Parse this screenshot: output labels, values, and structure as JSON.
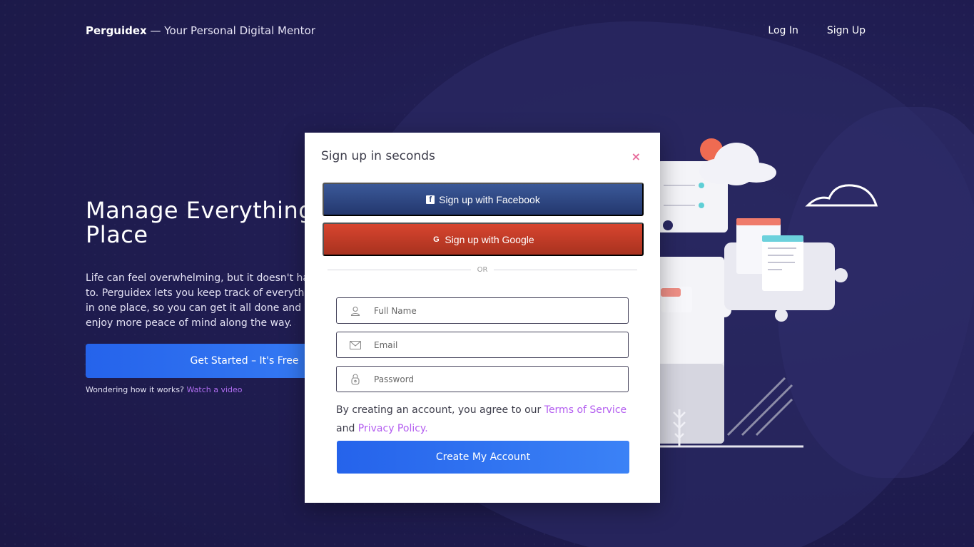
{
  "header": {
    "brand_name": "Perguidex",
    "brand_tagline": "— Your Personal Digital Mentor",
    "nav": {
      "login": "Log In",
      "signup": "Sign Up"
    }
  },
  "hero": {
    "title": "Manage Everything in One Place",
    "description": "Life can feel overwhelming, but it doesn't have to. Perguidex lets you keep track of everything in one place, so you can get it all done and enjoy more peace of mind along the way.",
    "cta_label": "Get Started – It's Free",
    "hint_text": "Wondering how it works?",
    "hint_link": "Watch a video"
  },
  "modal": {
    "title": "Sign up in seconds",
    "close_symbol": "×",
    "facebook_label": "Sign up with Facebook",
    "google_label": "Sign up with Google",
    "facebook_glyph": "f",
    "google_glyph": "G",
    "divider_text": "OR",
    "fields": {
      "full_name_placeholder": "Full Name",
      "email_placeholder": "Email",
      "password_placeholder": "Password"
    },
    "terms_prefix": "By creating an account, you agree to our",
    "terms_link": "Terms of Service",
    "terms_and": "and",
    "privacy_link": "Privacy Policy.",
    "submit_label": "Create My Account"
  },
  "icons": {
    "facebook": "facebook-icon",
    "google": "google-icon",
    "user": "user-icon",
    "email": "envelope-icon",
    "password": "lock-icon",
    "close": "close-icon"
  },
  "colors": {
    "background": "#201d52",
    "primary": "#2563eb",
    "facebook": "#3b5998",
    "google": "#d8452f",
    "link": "#b45ef0",
    "close": "#e76b9b"
  }
}
